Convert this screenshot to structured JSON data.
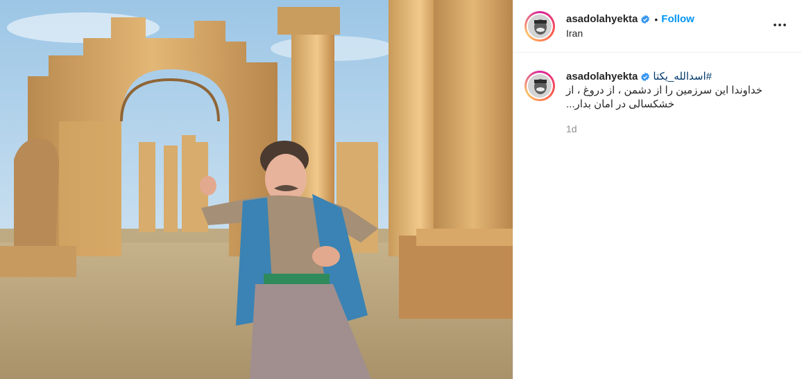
{
  "header": {
    "username": "asadolahyekta",
    "follow_label": "Follow",
    "dot": "•",
    "location": "Iran"
  },
  "caption": {
    "username": "asadolahyekta",
    "hashtag": "#اسدالله_یکتا",
    "line1": "خداوندا این سرزمین را از دشمن ، از دروغ ، از",
    "line2": "خشکسالی در امان بدار...",
    "time": "1d"
  },
  "colors": {
    "link_blue": "#0095f6",
    "hashtag": "#00376b",
    "verified_badge": "#3897f0",
    "muted": "#8e8e8e"
  },
  "icons": {
    "verified": "verified-badge-icon",
    "more": "more-options-icon"
  }
}
